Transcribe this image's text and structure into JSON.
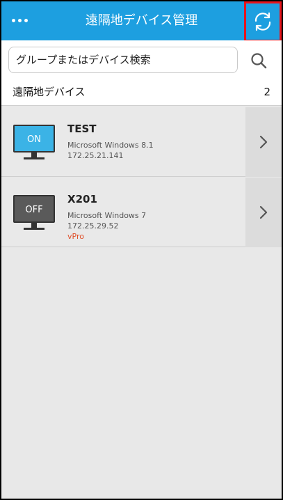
{
  "header": {
    "title": "遠隔地デバイス管理",
    "more_icon": "more-dots-icon",
    "refresh_icon": "refresh-icon",
    "background_color": "#1d9fe0",
    "highlight_color": "#e8141b"
  },
  "search": {
    "placeholder": "グループまたはデバイス検索",
    "icon": "search-icon"
  },
  "section": {
    "label": "遠隔地デバイス",
    "count": "2"
  },
  "devices": [
    {
      "name": "TEST",
      "os": "Microsoft Windows 8.1",
      "ip": "172.25.21.141",
      "status": "ON",
      "status_color": "#3bb3e6",
      "tag": ""
    },
    {
      "name": "X201",
      "os": "Microsoft Windows 7",
      "ip": "172.25.29.52",
      "status": "OFF",
      "status_color": "#5a5a5a",
      "tag": "vPro",
      "tag_color": "#e0502a"
    }
  ]
}
